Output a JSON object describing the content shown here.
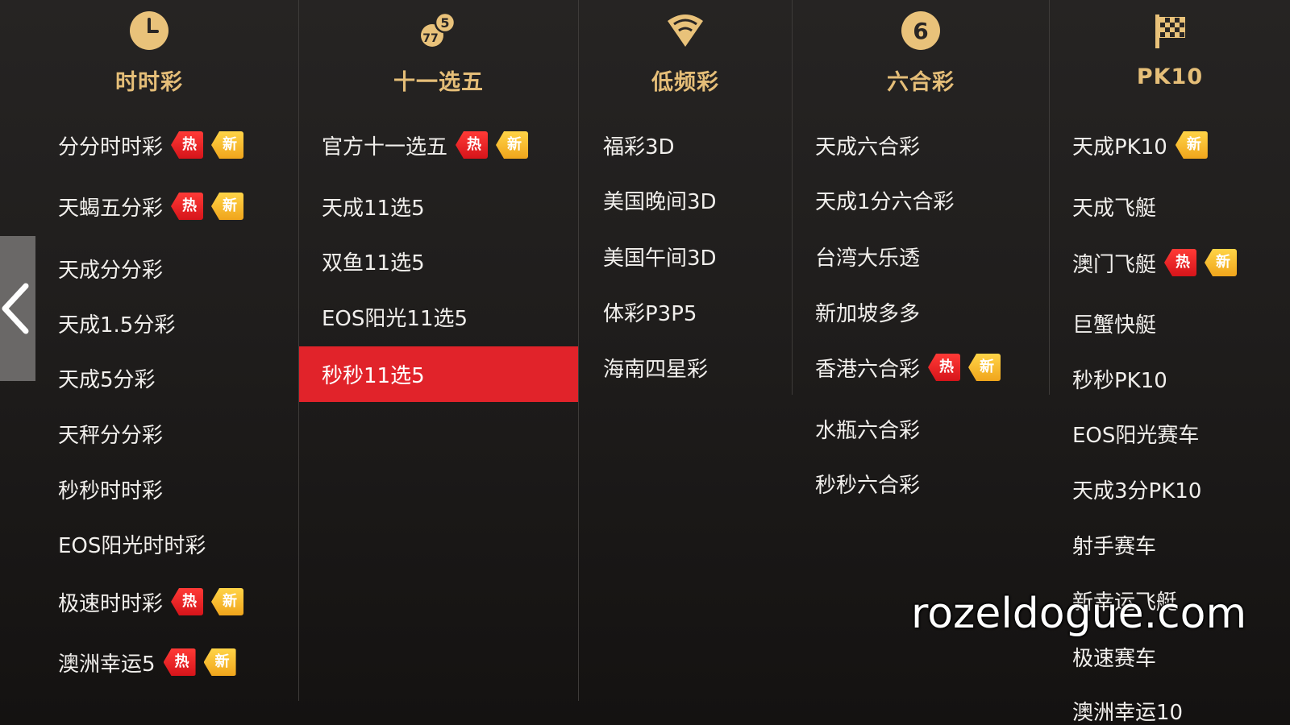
{
  "nav": {
    "prev_icon": "chevron-left-icon"
  },
  "badges": {
    "hot": "热",
    "new": "新"
  },
  "colors": {
    "title_gold": "#e5be78",
    "active_red": "#e1232a",
    "hot_red": "#e21c21",
    "new_gold": "#f5b52a",
    "text": "#f1efec"
  },
  "columns": [
    {
      "title": "时时彩",
      "icon": "clock-icon",
      "items": [
        {
          "label": "分分时时彩",
          "hot": true,
          "new": true
        },
        {
          "label": "天蝎五分彩",
          "hot": true,
          "new": true
        },
        {
          "label": "天成分分彩"
        },
        {
          "label": "天成1.5分彩"
        },
        {
          "label": "天成5分彩"
        },
        {
          "label": "天秤分分彩"
        },
        {
          "label": "秒秒时时彩"
        },
        {
          "label": "EOS阳光时时彩"
        },
        {
          "label": "极速时时彩",
          "hot": true,
          "new": true
        },
        {
          "label": "澳洲幸运5",
          "hot": true,
          "new": true
        }
      ]
    },
    {
      "title": "十一选五",
      "icon": "lottery-balls-icon",
      "items": [
        {
          "label": "官方十一选五",
          "hot": true,
          "new": true
        },
        {
          "label": "天成11选5"
        },
        {
          "label": "双鱼11选5"
        },
        {
          "label": "EOS阳光11选5"
        },
        {
          "label": "秒秒11选5",
          "active": true
        }
      ]
    },
    {
      "title": "低频彩",
      "icon": "wifi-signal-icon",
      "items": [
        {
          "label": "福彩3D"
        },
        {
          "label": "美国晚间3D"
        },
        {
          "label": "美国午间3D"
        },
        {
          "label": "体彩P3P5"
        },
        {
          "label": "海南四星彩"
        }
      ]
    },
    {
      "title": "六合彩",
      "icon": "number-six-icon",
      "icon_text": "6",
      "items": [
        {
          "label": "天成六合彩"
        },
        {
          "label": "天成1分六合彩"
        },
        {
          "label": "台湾大乐透"
        },
        {
          "label": "新加坡多多"
        },
        {
          "label": "香港六合彩",
          "hot": true,
          "new": true
        },
        {
          "label": "水瓶六合彩"
        },
        {
          "label": "秒秒六合彩"
        }
      ]
    },
    {
      "title": "PK10",
      "icon": "checkered-flag-icon",
      "items": [
        {
          "label": "天成PK10",
          "new": true
        },
        {
          "label": "天成飞艇"
        },
        {
          "label": "澳门飞艇",
          "hot": true,
          "new": true
        },
        {
          "label": "巨蟹快艇"
        },
        {
          "label": "秒秒PK10"
        },
        {
          "label": "EOS阳光赛车"
        },
        {
          "label": "天成3分PK10"
        },
        {
          "label": "射手赛车"
        },
        {
          "label": "新幸运飞艇"
        },
        {
          "label": "极速赛车"
        },
        {
          "label": "澳洲幸运10"
        }
      ]
    }
  ],
  "watermark": "rozeldogue.com"
}
